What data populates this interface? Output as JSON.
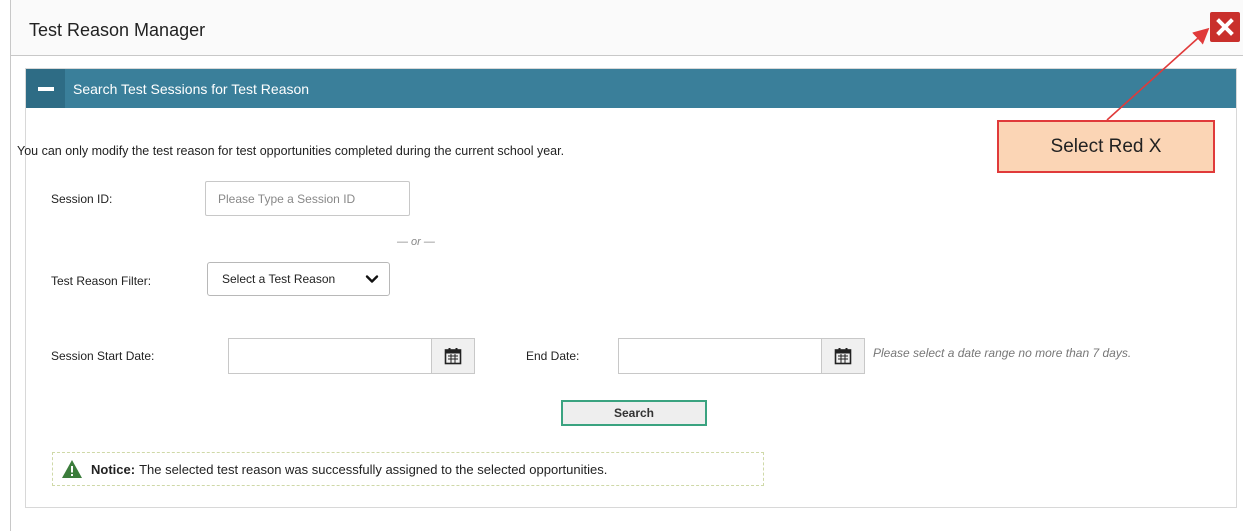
{
  "modal": {
    "title": "Test Reason Manager"
  },
  "panel": {
    "header_title": "Search Test Sessions for Test Reason",
    "info_text": "You can only modify the test reason for test opportunities completed during the current school year."
  },
  "form": {
    "session_id_label": "Session ID:",
    "session_id_placeholder": "Please Type a Session ID",
    "session_id_value": "",
    "or_divider": "— or —",
    "test_reason_label": "Test Reason Filter:",
    "test_reason_selected": "Select a Test Reason",
    "start_date_label": "Session Start Date:",
    "start_date_value": "",
    "end_date_label": "End Date:",
    "end_date_value": "",
    "date_hint": "Please select a date range no more than 7 days.",
    "search_label": "Search"
  },
  "notice": {
    "label": "Notice:",
    "message": "The selected test reason was successfully assigned to the selected opportunities."
  },
  "annotation": {
    "callout_text": "Select Red X",
    "callout_color": "#e03a3a"
  },
  "colors": {
    "header_bg": "#3a7f9a",
    "close_button_bg": "#c9302c",
    "search_border": "#3aa380",
    "warning_icon": "#3c7d3c"
  },
  "icons": {
    "close": "close-icon",
    "collapse": "minus-icon",
    "select": "chevron-down-icon",
    "calendar": "calendar-icon",
    "notice": "warning-triangle-icon"
  }
}
